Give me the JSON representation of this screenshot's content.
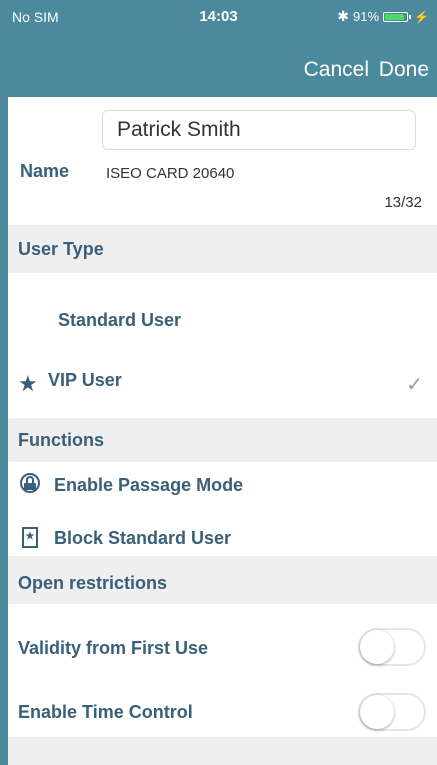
{
  "status_bar": {
    "carrier": "No SIM",
    "time": "14:03",
    "bluetooth_icon": "bluetooth-icon",
    "battery_text": "91%",
    "battery_level": 0.91,
    "battery_color": "#4cd964"
  },
  "nav": {
    "cancel_label": "Cancel",
    "done_label": "Done",
    "bar_color": "#4a8a9c"
  },
  "name_section": {
    "label": "Name",
    "value": "Patrick Smith",
    "card_label": "ISEO CARD 20640",
    "char_count": "13/32"
  },
  "user_type": {
    "header": "User Type",
    "options": [
      {
        "label": "Standard User",
        "icon": "",
        "selected": false
      },
      {
        "label": "VIP User",
        "icon": "star-icon",
        "selected": true
      }
    ]
  },
  "functions": {
    "header": "Functions",
    "items": [
      {
        "label": "Enable Passage Mode",
        "icon": "lock-circle-icon"
      },
      {
        "label": "Block Standard User",
        "icon": "badge-star-icon"
      }
    ]
  },
  "open_restrictions": {
    "header": "Open restrictions",
    "items": [
      {
        "label": "Validity from First Use",
        "on": false
      },
      {
        "label": "Enable Time Control",
        "on": false
      }
    ]
  },
  "colors": {
    "accent": "#3a5f7a",
    "section_bg": "#efefef"
  }
}
